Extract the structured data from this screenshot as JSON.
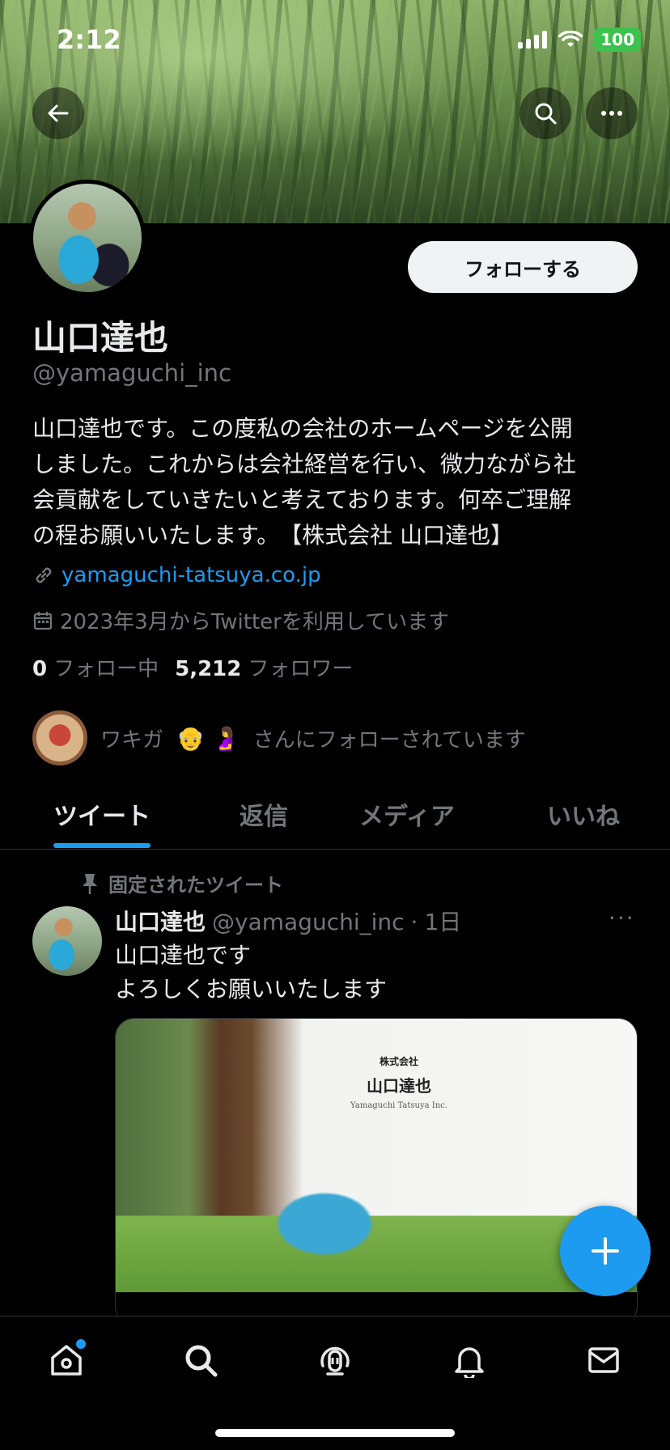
{
  "status_bar": {
    "time": "2:12",
    "battery": "100"
  },
  "header": {
    "back_icon": "back-arrow-icon",
    "search_icon": "search-icon",
    "more_icon": "more-icon"
  },
  "profile": {
    "follow_label": "フォローする",
    "name": "山口達也",
    "handle": "@yamaguchi_inc",
    "bio": "山口達也です。この度私の会社のホームページを公開\nしました。これからは会社経営を行い、微力ながら社\n会貢献をしていきたいと考えております。何卒ご理解\nの程お願いいたします。　【株式会社 山口達也】",
    "website": "yamaguchi-tatsuya.co.jp",
    "joined": "2023年3月からTwitterを利用しています",
    "following_count": "0",
    "following_label": "フォロー中",
    "followers_count": "5,212",
    "followers_label": "フォロワー",
    "followed_by_name": "ワキガ",
    "followed_by_emoji": "👴 🤰",
    "followed_by_suffix": "さんにフォローされています"
  },
  "tabs": [
    {
      "label": "ツイート",
      "active": true
    },
    {
      "label": "返信"
    },
    {
      "label": "メディア"
    },
    {
      "label": "いいね"
    }
  ],
  "tweet": {
    "pinned_label": "固定されたツイート",
    "name": "山口達也",
    "handle": "@yamaguchi_inc",
    "dot": "·",
    "time": "1日",
    "more": "···",
    "line1": "山口達也です",
    "line2": "よろしくお願いいたします",
    "card_brand_line1": "株式会社",
    "card_brand_line2": "山口達也",
    "card_brand_line3": "Yamaguchi Tatsuya Inc."
  },
  "colors": {
    "accent": "#1d9bf0",
    "background": "#000000",
    "text": "#e7e9ea",
    "muted": "#71767b"
  },
  "bottom_nav": [
    "home-icon",
    "search-icon",
    "spaces-icon",
    "notifications-icon",
    "messages-icon"
  ]
}
